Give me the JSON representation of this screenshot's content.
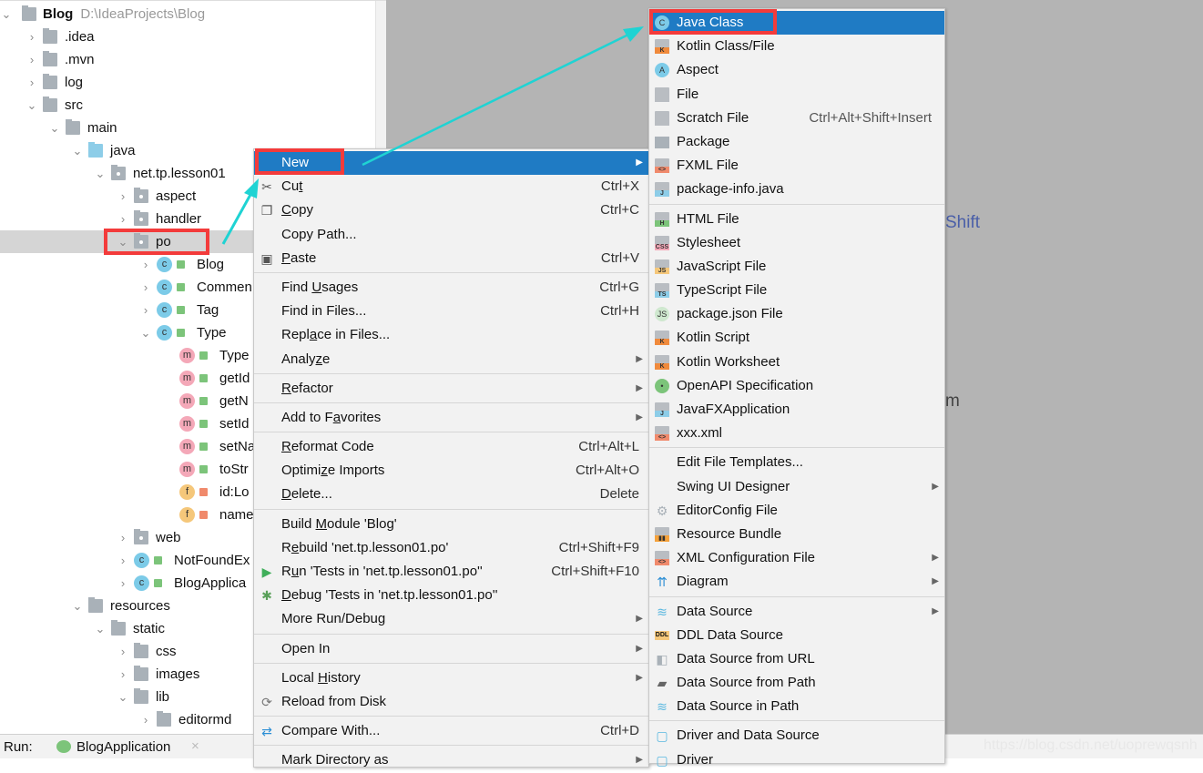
{
  "tree": {
    "project_name": "Blog",
    "project_path": "D:\\IdeaProjects\\Blog",
    "rows": [
      {
        "label": ".idea",
        "level": 1,
        "chev": "closed",
        "icon": "folder"
      },
      {
        "label": ".mvn",
        "level": 1,
        "chev": "closed",
        "icon": "folder"
      },
      {
        "label": "log",
        "level": 1,
        "chev": "closed",
        "icon": "folder"
      },
      {
        "label": "src",
        "level": 1,
        "chev": "open",
        "icon": "folder"
      },
      {
        "label": "main",
        "level": 2,
        "chev": "open",
        "icon": "folder"
      },
      {
        "label": "java",
        "level": 3,
        "chev": "open",
        "icon": "source-folder"
      },
      {
        "label": "net.tp.lesson01",
        "level": 4,
        "chev": "open",
        "icon": "package"
      },
      {
        "label": "aspect",
        "level": 5,
        "chev": "closed",
        "icon": "package"
      },
      {
        "label": "handler",
        "level": 5,
        "chev": "closed",
        "icon": "package"
      },
      {
        "label": "po",
        "level": 5,
        "chev": "open",
        "icon": "package",
        "selected": true
      },
      {
        "label": "Blog",
        "level": 6,
        "chev": "closed",
        "icon": "class"
      },
      {
        "label": "Commen",
        "level": 6,
        "chev": "closed",
        "icon": "class"
      },
      {
        "label": "Tag",
        "level": 6,
        "chev": "closed",
        "icon": "class"
      },
      {
        "label": "Type",
        "level": 6,
        "chev": "open",
        "icon": "class"
      },
      {
        "label": "Type",
        "level": 7,
        "chev": "none",
        "icon": "method"
      },
      {
        "label": "getId",
        "level": 7,
        "chev": "none",
        "icon": "method"
      },
      {
        "label": "getN",
        "level": 7,
        "chev": "none",
        "icon": "method"
      },
      {
        "label": "setId",
        "level": 7,
        "chev": "none",
        "icon": "method"
      },
      {
        "label": "setNa",
        "level": 7,
        "chev": "none",
        "icon": "method"
      },
      {
        "label": "toStr",
        "level": 7,
        "chev": "none",
        "icon": "method"
      },
      {
        "label": "id:Lo",
        "level": 7,
        "chev": "none",
        "icon": "field"
      },
      {
        "label": "name",
        "level": 7,
        "chev": "none",
        "icon": "field"
      },
      {
        "label": "web",
        "level": 5,
        "chev": "closed",
        "icon": "package"
      },
      {
        "label": "NotFoundEx",
        "level": 5,
        "chev": "closed",
        "icon": "class"
      },
      {
        "label": "BlogApplica",
        "level": 5,
        "chev": "closed",
        "icon": "spring-class"
      },
      {
        "label": "resources",
        "level": 3,
        "chev": "open",
        "icon": "resources-folder"
      },
      {
        "label": "static",
        "level": 4,
        "chev": "open",
        "icon": "folder"
      },
      {
        "label": "css",
        "level": 5,
        "chev": "closed",
        "icon": "folder"
      },
      {
        "label": "images",
        "level": 5,
        "chev": "closed",
        "icon": "folder"
      },
      {
        "label": "lib",
        "level": 5,
        "chev": "open",
        "icon": "folder"
      },
      {
        "label": "editormd",
        "level": 6,
        "chev": "closed",
        "icon": "folder"
      }
    ]
  },
  "editor": {
    "fragment_1": "Shift",
    "fragment_2": "m"
  },
  "bottom_bar": {
    "run_label": "Run:",
    "run_tab": "BlogApplication",
    "close": "×",
    "watermark": "https://blog.csdn.net/uoprewqsnh"
  },
  "context_menu": [
    {
      "label": "New",
      "arrow": true,
      "highlighted": true
    },
    {
      "label": "Cut",
      "u": "t",
      "shortcut": "Ctrl+X",
      "icon": "scissors-icon",
      "glyph": "✂"
    },
    {
      "label": "Copy",
      "u": "C",
      "shortcut": "Ctrl+C",
      "icon": "copy-icon",
      "glyph": "❐"
    },
    {
      "label": "Copy Path...",
      "shortcut": ""
    },
    {
      "label": "Paste",
      "u": "P",
      "shortcut": "Ctrl+V",
      "icon": "paste-icon",
      "glyph": "▣"
    },
    {
      "sep": true
    },
    {
      "label": "Find Usages",
      "u": "U",
      "shortcut": "Ctrl+G"
    },
    {
      "label": "Find in Files...",
      "shortcut": "Ctrl+H"
    },
    {
      "label": "Replace in Files...",
      "u": "a"
    },
    {
      "label": "Analyze",
      "u": "z",
      "arrow": true
    },
    {
      "sep": true
    },
    {
      "label": "Refactor",
      "u": "R",
      "arrow": true
    },
    {
      "sep": true
    },
    {
      "label": "Add to Favorites",
      "u": "a",
      "arrow": true
    },
    {
      "sep": true
    },
    {
      "label": "Reformat Code",
      "u": "R",
      "shortcut": "Ctrl+Alt+L"
    },
    {
      "label": "Optimize Imports",
      "u": "z",
      "shortcut": "Ctrl+Alt+O"
    },
    {
      "label": "Delete...",
      "u": "D",
      "shortcut": "Delete"
    },
    {
      "sep": true
    },
    {
      "label": "Build Module 'Blog'",
      "u": "M"
    },
    {
      "label": "Rebuild 'net.tp.lesson01.po'",
      "u": "e",
      "shortcut": "Ctrl+Shift+F9"
    },
    {
      "label": "Run 'Tests in 'net.tp.lesson01.po''",
      "u": "u",
      "shortcut": "Ctrl+Shift+F10",
      "icon": "run-icon",
      "glyph": "▶",
      "color": "#3fae5a"
    },
    {
      "label": "Debug 'Tests in 'net.tp.lesson01.po''",
      "u": "D",
      "icon": "debug-icon",
      "glyph": "✱",
      "color": "#5aa05a"
    },
    {
      "label": "More Run/Debug",
      "arrow": true
    },
    {
      "sep": true
    },
    {
      "label": "Open In",
      "arrow": true
    },
    {
      "sep": true
    },
    {
      "label": "Local History",
      "u": "H",
      "arrow": true
    },
    {
      "label": "Reload from Disk",
      "icon": "reload-icon",
      "glyph": "⟳",
      "color": "#777"
    },
    {
      "sep": true
    },
    {
      "label": "Compare With...",
      "shortcut": "Ctrl+D",
      "icon": "compare-icon",
      "glyph": "⇄",
      "color": "#2d8fd5"
    },
    {
      "sep": true
    },
    {
      "label": "Mark Directory as",
      "arrow": true
    }
  ],
  "new_submenu": [
    {
      "label": "Java Class",
      "highlighted": true,
      "icon": "java-class-icon",
      "kind": "circle",
      "tag": "C",
      "color": "#7ccbe8"
    },
    {
      "label": "Kotlin Class/File",
      "icon": "kotlin-icon",
      "kind": "file",
      "tag": "K",
      "color": "#f08a3c"
    },
    {
      "label": "Aspect",
      "icon": "aspect-icon",
      "kind": "circle",
      "tag": "A",
      "color": "#7ccbe8"
    },
    {
      "label": "File",
      "icon": "file-icon",
      "kind": "file",
      "tag": "",
      "color": "#b9bdc2"
    },
    {
      "label": "Scratch File",
      "shortcut": "Ctrl+Alt+Shift+Insert",
      "icon": "scratch-file-icon",
      "kind": "file",
      "tag": "",
      "color": "#b9bdc2"
    },
    {
      "label": "Package",
      "icon": "package-icon",
      "kind": "folder",
      "tag": "",
      "color": "#a9b1b8"
    },
    {
      "label": "FXML File",
      "icon": "fxml-icon",
      "kind": "file",
      "tag": "<>",
      "color": "#f08a6c"
    },
    {
      "label": "package-info.java",
      "icon": "java-file-icon",
      "kind": "file",
      "tag": "J",
      "color": "#8dcde8"
    },
    {
      "sep": true
    },
    {
      "label": "HTML File",
      "icon": "html-icon",
      "kind": "file",
      "tag": "H",
      "color": "#7cc47a"
    },
    {
      "label": "Stylesheet",
      "icon": "css-icon",
      "kind": "file",
      "tag": "CSS",
      "color": "#f4a8b8"
    },
    {
      "label": "JavaScript File",
      "icon": "js-icon",
      "kind": "file",
      "tag": "JS",
      "color": "#f5c77a"
    },
    {
      "label": "TypeScript File",
      "icon": "ts-icon",
      "kind": "file",
      "tag": "TS",
      "color": "#8dcde8"
    },
    {
      "label": "package.json File",
      "icon": "nodejs-icon",
      "kind": "circle",
      "tag": "JS",
      "color": "#cfe8cf"
    },
    {
      "label": "Kotlin Script",
      "icon": "kotlin-script-icon",
      "kind": "file",
      "tag": "K",
      "color": "#f08a3c"
    },
    {
      "label": "Kotlin Worksheet",
      "icon": "kotlin-worksheet-icon",
      "kind": "file",
      "tag": "K",
      "color": "#f08a3c"
    },
    {
      "label": "OpenAPI Specification",
      "icon": "openapi-icon",
      "kind": "circle",
      "tag": "•",
      "color": "#7cc47a"
    },
    {
      "label": "JavaFXApplication",
      "icon": "javafx-icon",
      "kind": "file",
      "tag": "J",
      "color": "#8dcde8"
    },
    {
      "label": "xxx.xml",
      "icon": "xml-icon",
      "kind": "file",
      "tag": "<>",
      "color": "#f08a6c"
    },
    {
      "sep": true
    },
    {
      "label": "Edit File Templates..."
    },
    {
      "label": "Swing UI Designer",
      "arrow": true
    },
    {
      "label": "EditorConfig File",
      "icon": "gear-icon",
      "kind": "glyph",
      "tag": "⚙",
      "color": "#a9b1b8"
    },
    {
      "label": "Resource Bundle",
      "icon": "resource-bundle-icon",
      "kind": "file",
      "tag": "▮▮",
      "color": "#f5a23c"
    },
    {
      "label": "XML Configuration File",
      "arrow": true,
      "icon": "xml-config-icon",
      "kind": "file",
      "tag": "<>",
      "color": "#f08a6c"
    },
    {
      "label": "Diagram",
      "arrow": true,
      "icon": "diagram-icon",
      "kind": "glyph",
      "tag": "⇈",
      "color": "#2d8fd5"
    },
    {
      "sep": true
    },
    {
      "label": "Data Source",
      "arrow": true,
      "icon": "database-icon",
      "kind": "glyph",
      "tag": "≋",
      "color": "#5bb8e0"
    },
    {
      "label": "DDL Data Source",
      "icon": "ddl-icon",
      "kind": "box",
      "tag": "DDL",
      "color": "#f5c77a"
    },
    {
      "label": "Data Source from URL",
      "icon": "plug-icon",
      "kind": "glyph",
      "tag": "◧",
      "color": "#a9b1b8"
    },
    {
      "label": "Data Source from Path",
      "icon": "folder-open-icon",
      "kind": "glyph",
      "tag": "▰",
      "color": "#666"
    },
    {
      "label": "Data Source in Path",
      "icon": "database-icon",
      "kind": "glyph",
      "tag": "≋",
      "color": "#5bb8e0"
    },
    {
      "sep": true
    },
    {
      "label": "Driver and Data Source",
      "icon": "driver-icon",
      "kind": "glyph",
      "tag": "▢",
      "color": "#5bb8e0"
    },
    {
      "label": "Driver",
      "icon": "driver-icon",
      "kind": "glyph",
      "tag": "▢",
      "color": "#5bb8e0"
    }
  ],
  "annotation": {
    "box_color": "#f33b3b",
    "arrow_color": "#1fd3d3"
  }
}
